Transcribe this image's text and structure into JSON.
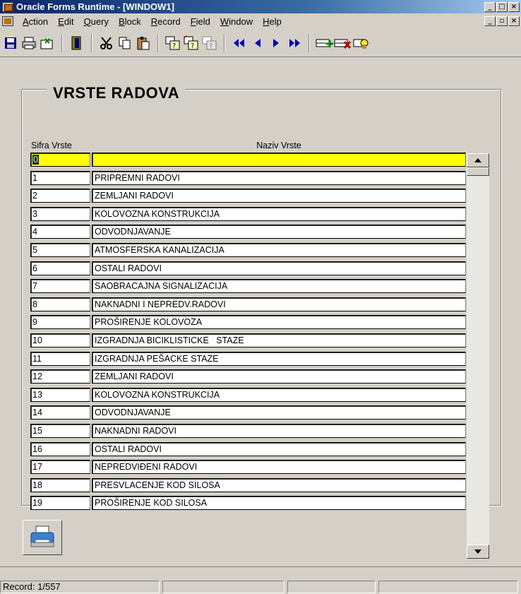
{
  "window": {
    "title": "Oracle Forms Runtime - [WINDOW1]",
    "buttons": {
      "minimize": "_",
      "maximize": "□",
      "close": "×",
      "restore": "▫"
    }
  },
  "menu": {
    "items": [
      {
        "prefix": "",
        "accel": "A",
        "rest": "ction"
      },
      {
        "prefix": "",
        "accel": "E",
        "rest": "dit"
      },
      {
        "prefix": "",
        "accel": "Q",
        "rest": "uery"
      },
      {
        "prefix": "",
        "accel": "B",
        "rest": "lock"
      },
      {
        "prefix": "",
        "accel": "R",
        "rest": "ecord"
      },
      {
        "prefix": "",
        "accel": "F",
        "rest": "ield"
      },
      {
        "prefix": "",
        "accel": "W",
        "rest": "indow"
      },
      {
        "prefix": "",
        "accel": "H",
        "rest": "elp"
      }
    ]
  },
  "toolbar": {
    "icons": [
      "save-icon",
      "print-icon",
      "clear-icon",
      "exit-icon",
      "cut-icon",
      "copy-icon",
      "paste-icon",
      "enter-query-icon",
      "execute-query-icon",
      "cancel-query-icon",
      "previous-block-icon",
      "previous-record-icon",
      "next-record-icon",
      "next-block-icon",
      "insert-record-icon",
      "delete-record-icon",
      "help-icon"
    ]
  },
  "form": {
    "frame_title": "VRSTE RADOVA",
    "columns": {
      "code": "Sifra Vrste",
      "name": "Naziv Vrste"
    },
    "rows": [
      {
        "code": "0",
        "name": ""
      },
      {
        "code": "1",
        "name": "PRIPREMNI RADOVI"
      },
      {
        "code": "2",
        "name": "ZEMLJANI RADOVI"
      },
      {
        "code": "3",
        "name": "KOLOVOZNA KONSTRUKCIJA"
      },
      {
        "code": "4",
        "name": "ODVODNJAVANJE"
      },
      {
        "code": "5",
        "name": "ATMOSFERSKA KANALIZACIJA"
      },
      {
        "code": "6",
        "name": "OSTALI RADOVI"
      },
      {
        "code": "7",
        "name": "SAOBRACAJNA SIGNALIZACIJA"
      },
      {
        "code": "8",
        "name": "NAKNADNI I NEPREDV.RADOVI"
      },
      {
        "code": "9",
        "name": "PROŠIRENJE KOLOVOZA"
      },
      {
        "code": "10",
        "name": "IZGRADNJA BICIKLISTICKE   STAZE"
      },
      {
        "code": "11",
        "name": "IZGRADNJA PEŠACKE STAZE"
      },
      {
        "code": "12",
        "name": "ZEMLJANI RADOVI"
      },
      {
        "code": "13",
        "name": "KOLOVOZNA KONSTRUKCIJA"
      },
      {
        "code": "14",
        "name": "ODVODNJAVANJE"
      },
      {
        "code": "15",
        "name": "NAKNADNI RADOVI"
      },
      {
        "code": "16",
        "name": "OSTALI RADOVI"
      },
      {
        "code": "17",
        "name": "NEPREDVIĐENI RADOVI"
      },
      {
        "code": "18",
        "name": "PRESVLACENJE KOD SILOSA"
      },
      {
        "code": "19",
        "name": "PROŠIRENJE KOD SILOSA"
      }
    ],
    "current_row": 0
  },
  "status": {
    "record": "Record: 1/557",
    "message": ""
  },
  "colors": {
    "current_record": "#ffff00",
    "face": "#d4d0c8",
    "title_active": "#0a246a"
  }
}
